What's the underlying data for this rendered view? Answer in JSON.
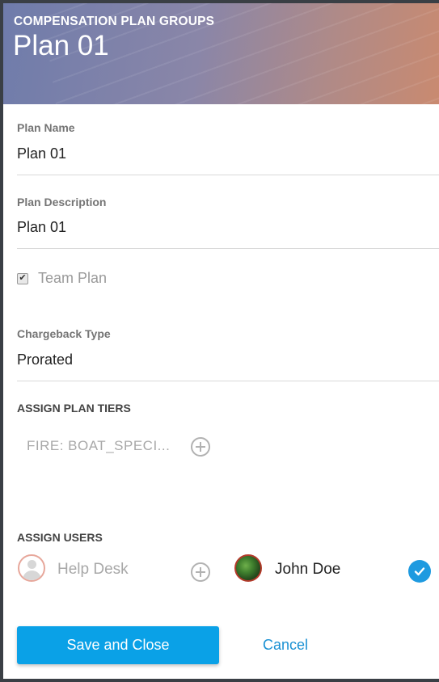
{
  "header": {
    "kicker": "COMPENSATION PLAN GROUPS",
    "title": "Plan 01"
  },
  "fields": {
    "plan_name": {
      "label": "Plan Name",
      "value": "Plan 01"
    },
    "plan_description": {
      "label": "Plan Description",
      "value": "Plan 01"
    },
    "chargeback_type": {
      "label": "Chargeback Type",
      "value": "Prorated"
    }
  },
  "team_plan": {
    "label": "Team Plan",
    "checked": true
  },
  "assign_plan_tiers": {
    "title": "ASSIGN PLAN TIERS",
    "items": [
      "FIRE: BOAT_SPECI..."
    ]
  },
  "assign_users": {
    "title": "ASSIGN USERS",
    "available": [
      "Help Desk"
    ],
    "assigned": [
      "John Doe"
    ]
  },
  "actions": {
    "save_label": "Save and Close",
    "cancel_label": "Cancel"
  },
  "colors": {
    "primary": "#0aa1e7",
    "link": "#1a91d3",
    "check_badge": "#1e9ae0"
  }
}
